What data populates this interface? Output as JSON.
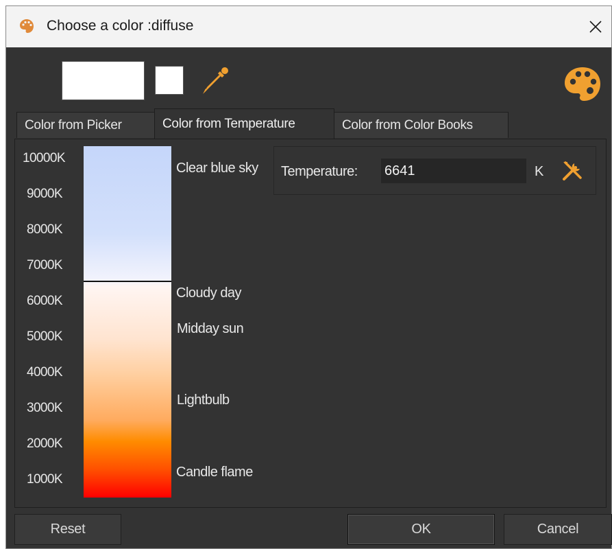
{
  "window": {
    "title": "Choose a color :diffuse",
    "title_icon": "palette-icon",
    "close_icon": "close-icon"
  },
  "toolbar": {
    "current_color": "#ffffff",
    "previous_color": "#ffffff",
    "eyedropper_icon": "eyedropper-icon",
    "palette_icon": "palette-icon",
    "icon_color": "#f0a030"
  },
  "tabs": [
    {
      "label": "Color from Picker",
      "active": false
    },
    {
      "label": "Color from Temperature",
      "active": true
    },
    {
      "label": "Color from Color Books",
      "active": false
    }
  ],
  "scale": {
    "labels": [
      "10000K",
      "9000K",
      "8000K",
      "7000K",
      "6000K",
      "5000K",
      "4000K",
      "3000K",
      "2000K",
      "1000K"
    ],
    "selected_kelvin": 6641
  },
  "references": [
    {
      "label": "Clear blue sky"
    },
    {
      "label": "Cloudy day"
    },
    {
      "label": "Midday sun"
    },
    {
      "label": "Lightbulb"
    },
    {
      "label": "Candle flame"
    }
  ],
  "temperature": {
    "label": "Temperature:",
    "value": "6641",
    "unit": "K",
    "tools_icon": "tools-icon"
  },
  "buttons": {
    "reset": "Reset",
    "ok": "OK",
    "cancel": "Cancel"
  }
}
